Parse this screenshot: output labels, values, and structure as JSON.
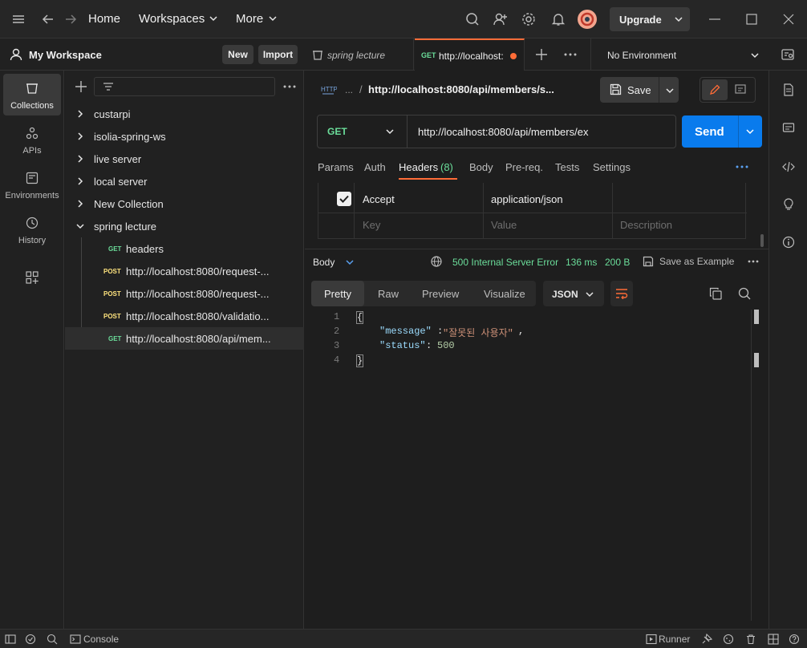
{
  "topbar": {
    "home": "Home",
    "workspaces": "Workspaces",
    "more": "More",
    "upgrade": "Upgrade"
  },
  "workspace": {
    "name": "My Workspace",
    "new_label": "New",
    "import_label": "Import"
  },
  "tabs": [
    {
      "label": "spring lecture"
    },
    {
      "method": "GET",
      "label": "http://localhost:"
    }
  ],
  "environment": "No Environment",
  "sidebar": {
    "items": [
      {
        "label": "Collections"
      },
      {
        "label": "APIs"
      },
      {
        "label": "Environments"
      },
      {
        "label": "History"
      }
    ]
  },
  "tree": {
    "collections": [
      "custarpi",
      "isolia-spring-ws",
      "live server",
      "local server",
      "New Collection",
      "spring lecture"
    ],
    "requests": [
      {
        "method": "GET",
        "name": "headers"
      },
      {
        "method": "POST",
        "name": "http://localhost:8080/request-..."
      },
      {
        "method": "POST",
        "name": "http://localhost:8080/request-..."
      },
      {
        "method": "POST",
        "name": "http://localhost:8080/validatio..."
      },
      {
        "method": "GET",
        "name": "http://localhost:8080/api/mem..."
      }
    ]
  },
  "request": {
    "breadcrumb_ellipsis": "...",
    "breadcrumb_sep": "/",
    "title": "http://localhost:8080/api/members/s...",
    "save_label": "Save",
    "method": "GET",
    "url": "http://localhost:8080/api/members/ex",
    "send_label": "Send",
    "subtabs": {
      "params": "Params",
      "auth": "Auth",
      "headers": "Headers",
      "headers_count": "(8)",
      "body": "Body",
      "prereq": "Pre-req.",
      "tests": "Tests",
      "settings": "Settings"
    },
    "headers_table": {
      "key": "Accept",
      "value": "application/json",
      "key_placeholder": "Key",
      "value_placeholder": "Value",
      "desc_placeholder": "Description"
    }
  },
  "response": {
    "body_label": "Body",
    "status": "500 Internal Server Error",
    "time": "136 ms",
    "size": "200 B",
    "save_example": "Save as Example",
    "views": [
      "Pretty",
      "Raw",
      "Preview",
      "Visualize"
    ],
    "format": "JSON",
    "line_numbers": [
      "1",
      "2",
      "3",
      "4"
    ],
    "code": {
      "open": "{",
      "message_key": "\"message\"",
      "message_val": "\"잘못된 사용자\"",
      "status_key": "\"status\"",
      "status_val": "500",
      "close": "}"
    }
  },
  "statusbar": {
    "console": "Console",
    "runner": "Runner"
  },
  "colors": {
    "accent": "#ff6c37",
    "send": "#097bed",
    "get": "#6bdd9a",
    "post": "#ffe47e",
    "error": "#6bdd9a"
  }
}
